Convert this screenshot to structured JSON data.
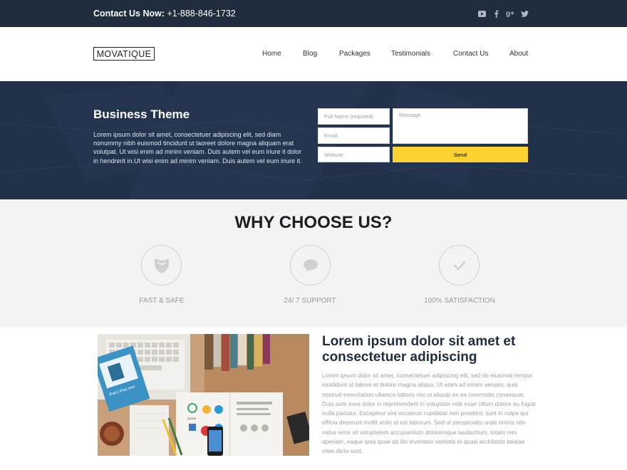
{
  "topbar": {
    "contact_label": "Contact Us Now:",
    "phone": "+1-888-846-1732",
    "social": [
      {
        "icon": "youtube-icon"
      },
      {
        "icon": "facebook-icon"
      },
      {
        "icon": "google-plus-icon",
        "text": "g+"
      },
      {
        "icon": "twitter-icon"
      }
    ]
  },
  "header": {
    "logo": "MOVATIQUE",
    "nav": [
      "Home",
      "Blog",
      "Packages",
      "Testimonials",
      "Contact Us",
      "About"
    ]
  },
  "hero": {
    "title": "Business Theme",
    "text": "Lorem ipsum dolor sit amet, consectetuer adipiscing elit, sed diam nonummy nibh euismod tincidunt ut laoreet dolore magna aliquam erat volutpat. Ut wisi enim ad minim veniam. Duis autem vel eum iriure it dolor in hendrerit in.Ut wisi enim ad minim veniam. Duis autem vel eum iriure it.",
    "form": {
      "name_placeholder": "Full Name (required)",
      "email_placeholder": "Email",
      "website_placeholder": "Website",
      "message_placeholder": "Message",
      "send_label": "Send"
    }
  },
  "why": {
    "title": "WHY CHOOSE US?",
    "features": [
      {
        "label": "FAST & SAFE",
        "icon": "shield-icon"
      },
      {
        "label": "24/ 7 SUPPORT",
        "icon": "chat-bubble-icon"
      },
      {
        "label": "100% SATISFACTION",
        "icon": "checkmark-icon"
      }
    ]
  },
  "content": {
    "title": "Lorem ipsum dolor sit amet et consectetuer adipiscing",
    "text": "Lorem ipsum dolor sit amet, consectetuer adipiscing elit, sed do eiusmod tempor incididunt ut labore et dolore magna aliqua. Ut enim ad minim veniam, quis nostrud exercitation ullamco laboris nisi ut aliquip ex ea commodo consequat. Duis aute irure dolor in reprehenderit in voluptate velit esse cillum dolore eu fugiat nulla pariatur. Excepteur sint occaecat cupidatat non proident, sunt in culpa qui officia deserunt mollit anim id est laborum. Sed ut perspiciatis unde omnis iste natus error sit voluptatem accusantium doloremque laudantium, totam rem aperiam, eaque ipsa quae ab illo inventore veritatis et quasi architecto beatae vitae dicta sunt.",
    "photo_text": {
      "magazine": "iPad | iPad mini",
      "book": "Quark"
    }
  },
  "colors": {
    "topbar_bg": "#1f2d3f",
    "hero_bg": "#243349",
    "accent_yellow": "#fdd230",
    "section_gray": "#f3f3f3"
  }
}
